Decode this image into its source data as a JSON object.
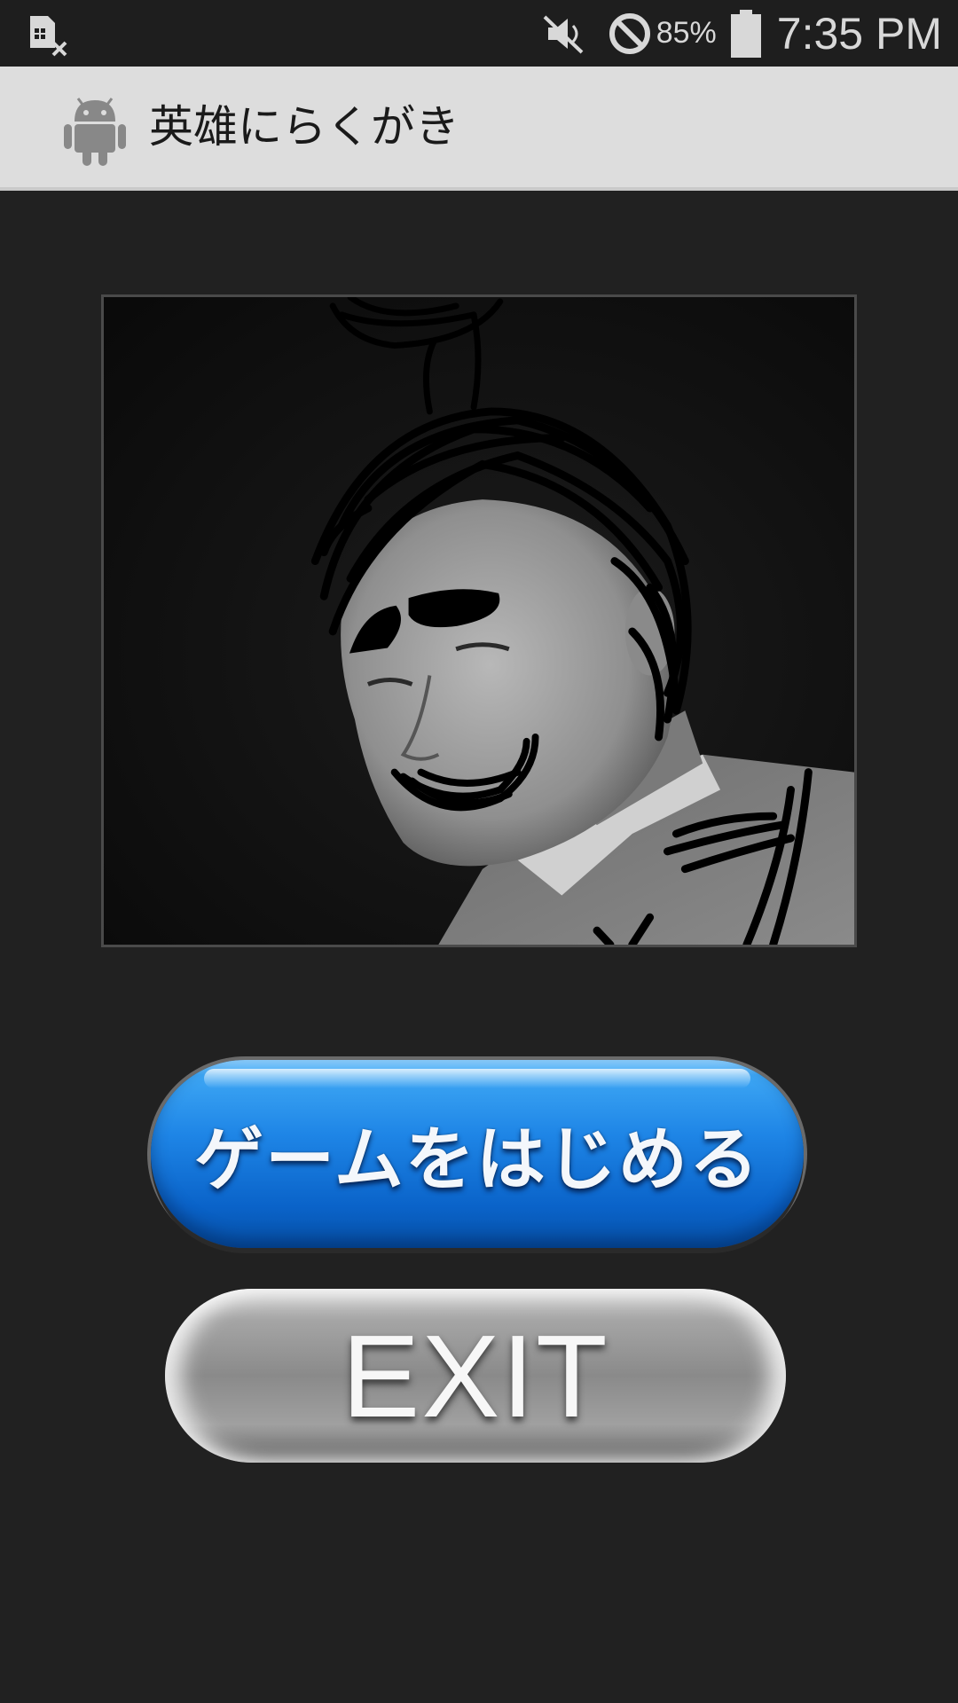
{
  "status_bar": {
    "left_icon": "sim-disabled-icon",
    "icons": [
      "vibrate-mute-icon",
      "do-not-disturb-icon",
      "battery-icon"
    ],
    "battery_percent": "85%",
    "time": "7:35 PM"
  },
  "action_bar": {
    "app_icon": "android-icon",
    "title": "英雄にらくがき"
  },
  "main": {
    "portrait_image": "graffiti-portrait",
    "start_button_label": "ゲームをはじめる",
    "exit_button_label": "EXIT"
  },
  "colors": {
    "background": "#212121",
    "action_bar": "#dddddd",
    "start_button": "#1e85e6",
    "exit_button": "#8a8a8a"
  }
}
